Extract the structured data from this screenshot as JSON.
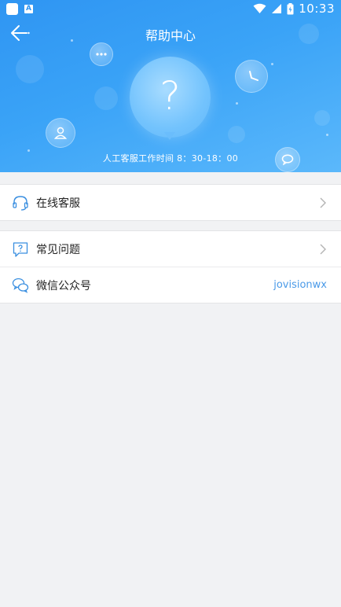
{
  "status_bar": {
    "time": "10:33",
    "badge": "A",
    "icons": [
      "app-icon",
      "a-badge-icon",
      "wifi-icon",
      "cell-signal-icon",
      "battery-icon"
    ]
  },
  "header": {
    "title": "帮助中心",
    "back_icon": "back-arrow-icon"
  },
  "hero": {
    "question_mark": "?",
    "service_hours": "人工客服工作时间 8：30-18：00",
    "decor_icons": [
      "chat-dots-icon",
      "clock-icon",
      "user-icon",
      "chat-bubble-icon",
      "question-bubble-icon"
    ]
  },
  "sections": [
    {
      "items": [
        {
          "label": "在线客服",
          "icon": "headset-icon",
          "has_chevron": true
        }
      ]
    },
    {
      "items": [
        {
          "label": "常见问题",
          "icon": "faq-icon",
          "has_chevron": true
        },
        {
          "label": "微信公众号",
          "icon": "wechat-icon",
          "value": "jovisionwx"
        }
      ]
    }
  ],
  "colors": {
    "hero_blue": "#3aa3f7",
    "accent_text": "#4a9ae8",
    "icon_blue": "#3a8fe0",
    "background": "#f1f2f4"
  }
}
